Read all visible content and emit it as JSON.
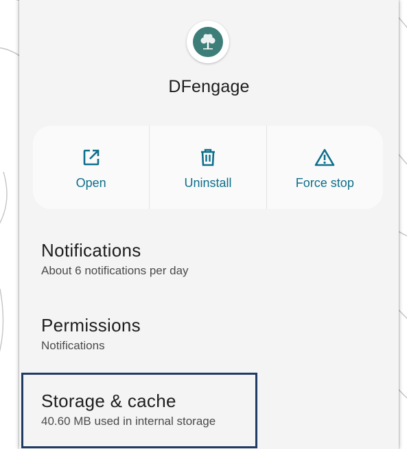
{
  "app": {
    "name": "DFengage",
    "icon": "tree-logo-icon",
    "icon_color": "#3e7e78"
  },
  "actions": [
    {
      "label": "Open",
      "icon": "open-external-icon"
    },
    {
      "label": "Uninstall",
      "icon": "trash-icon"
    },
    {
      "label": "Force stop",
      "icon": "warning-triangle-icon"
    }
  ],
  "preferences": {
    "notifications": {
      "title": "Notifications",
      "summary": "About 6 notifications per day"
    },
    "permissions": {
      "title": "Permissions",
      "summary": "Notifications"
    },
    "storage": {
      "title": "Storage & cache",
      "summary": "40.60 MB used in internal storage"
    }
  },
  "colors": {
    "accent": "#0d6e8a",
    "highlight_border": "#1f3a63",
    "background": "#f4f4f4"
  }
}
